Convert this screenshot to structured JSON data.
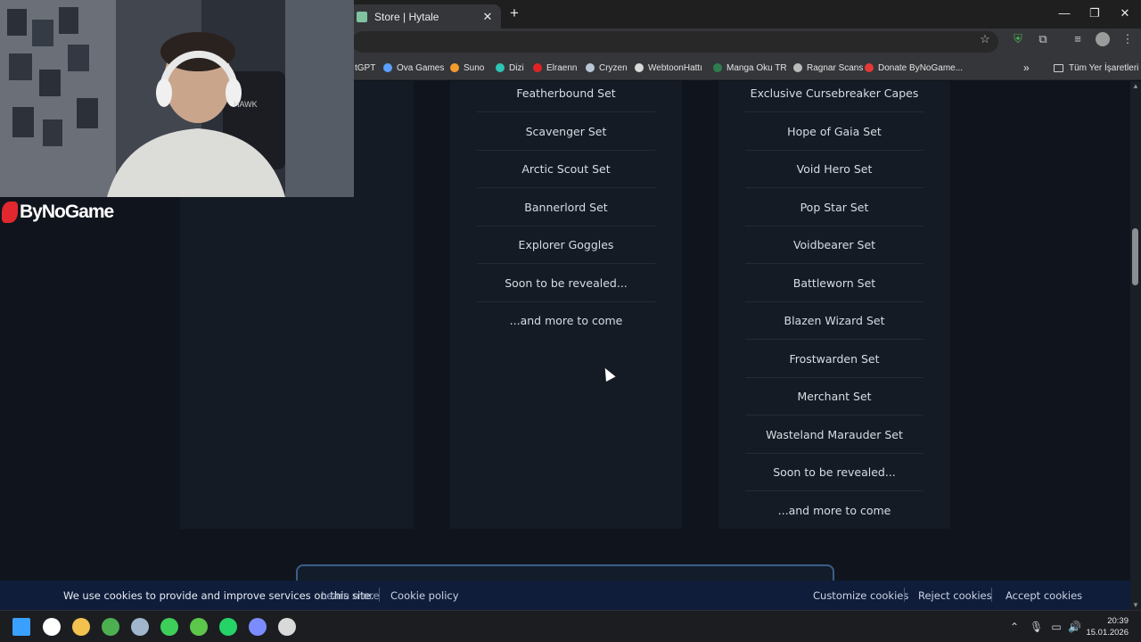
{
  "browser": {
    "tab_title": "Store | Hytale",
    "new_tab": "+",
    "close": "✕",
    "win_min": "—",
    "win_max": "❐",
    "win_close": "✕",
    "bookmarks": [
      {
        "label": "tGPT",
        "color": "#74aa9c"
      },
      {
        "label": "Ova Games",
        "color": "#5aa0ff"
      },
      {
        "label": "Suno",
        "color": "#f59a2c"
      },
      {
        "label": "Dizi",
        "color": "#2ec4b6"
      },
      {
        "label": "Elraenn",
        "color": "#e02424"
      },
      {
        "label": "Cryzen",
        "color": "#b9c6d6"
      },
      {
        "label": "WebtoonHattı",
        "color": "#d9d9d9"
      },
      {
        "label": "Manga Oku TR",
        "color": "#2f7d4f"
      },
      {
        "label": "Ragnar Scans",
        "color": "#bbbbbb"
      },
      {
        "label": "Donate ByNoGame...",
        "color": "#e53935"
      }
    ],
    "bookmarks_more": "»",
    "all_bookmarks": "Tüm Yer İşaretleri"
  },
  "store": {
    "middle_items": [
      "Featherbound Set",
      "Scavenger Set",
      "Arctic Scout Set",
      "Bannerlord Set",
      "Explorer Goggles",
      "Soon to be revealed...",
      "...and more to come"
    ],
    "right_items": [
      "Exclusive Cursebreaker Capes",
      "Hope of Gaia Set",
      "Void Hero Set",
      "Pop Star Set",
      "Voidbearer Set",
      "Battleworn Set",
      "Blazen Wizard Set",
      "Frostwarden Set",
      "Merchant Set",
      "Wasteland Marauder Set",
      "Soon to be revealed...",
      "...and more to come"
    ]
  },
  "cookie_banner": {
    "message": "We use cookies to provide and improve services on this site.",
    "learn_more": "Learn more",
    "cookie_policy": "Cookie policy",
    "customize": "Customize cookies",
    "reject": "Reject cookies",
    "accept": "Accept cookies"
  },
  "overlay": {
    "logo_text": "ByNoGame"
  },
  "taskbar": {
    "time": "20:39",
    "date": "15.01.2026",
    "apps": [
      {
        "name": "windows-start",
        "color": "#3aa0ff"
      },
      {
        "name": "yandex",
        "color": "#ffffff"
      },
      {
        "name": "file-explorer",
        "color": "#f2c14e"
      },
      {
        "name": "chrome",
        "color": "#4caf50"
      },
      {
        "name": "steam",
        "color": "#9fb6cc"
      },
      {
        "name": "green-app",
        "color": "#3ecf5a"
      },
      {
        "name": "utorrent",
        "color": "#5cc64b"
      },
      {
        "name": "whatsapp",
        "color": "#25d366"
      },
      {
        "name": "discord",
        "color": "#7b8cff"
      },
      {
        "name": "obs",
        "color": "#d9d9d9"
      }
    ]
  }
}
